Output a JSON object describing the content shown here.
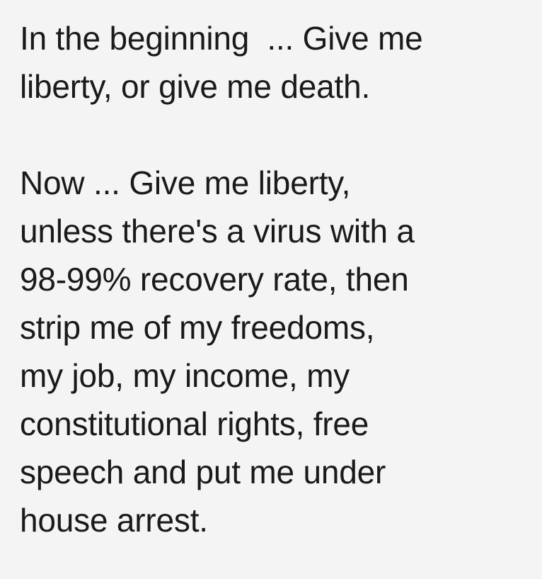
{
  "paragraphs": [
    {
      "lines": [
        "In the beginning  ... Give me",
        "liberty, or give me death."
      ]
    },
    {
      "lines": [
        "Now ... Give me liberty,",
        "unless there's a virus with a",
        "98-99% recovery rate, then",
        "strip me of my freedoms,",
        "my job, my income, my",
        "constitutional rights, free",
        "speech and put me under",
        "house arrest."
      ]
    }
  ]
}
